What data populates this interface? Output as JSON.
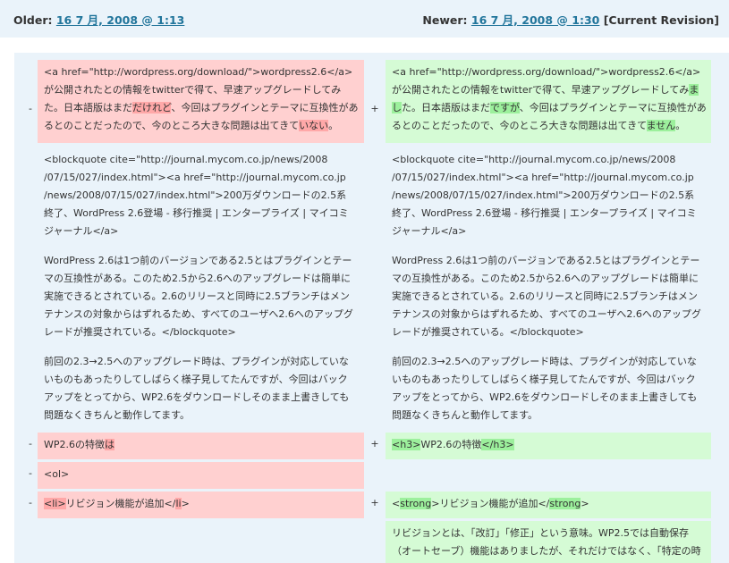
{
  "header": {
    "older_label": "Older:",
    "older_link": "16 7 月, 2008 @ 1:13",
    "newer_label": "Newer:",
    "newer_link": "16 7 月, 2008 @ 1:30",
    "current_revision": "[Current Revision]"
  },
  "markers": {
    "minus": "-",
    "plus": "+"
  },
  "colors": {
    "deleted_bg": "#ffd0d0",
    "inserted_bg": "#d5fbd5",
    "deleted_hl": "#ffa8a8",
    "inserted_hl": "#9cf09c",
    "link": "#21759b"
  },
  "rows": {
    "r1": {
      "left": {
        "l1": "<a href=\"http://wordpress.org/download/\">wordpress2.6</a>",
        "l2": "が公開されたとの情報をtwitterで得て、早速アップグレードしてみ",
        "l3a": "た。日本語版はまだ",
        "l3b": "だけれど",
        "l3c": "、今回はプラグインとテーマに互換性があ",
        "l4a": "るとのことだったので、今のところ大きな問題は出てきて",
        "l4b": "いない",
        "l4c": "。"
      },
      "right": {
        "l1": "<a href=\"http://wordpress.org/download/\">wordpress2.6</a>",
        "l2a": "が公開されたとの情報をtwitterで得て、早速アップグレードしてみ",
        "l2b": "ま",
        "l3a": "し",
        "l3b": "た。日本語版はまだ",
        "l3c": "ですが",
        "l3d": "、今回はプラグインとテーマに互換性があ",
        "l4a": "るとのことだったので、今のところ大きな問題は出てきて",
        "l4b": "ません",
        "l4c": "。"
      }
    },
    "r2": {
      "l1": "<blockquote cite=\"http://journal.mycom.co.jp/news/2008",
      "l2": "/07/15/027/index.html\"><a href=\"http://journal.mycom.co.jp",
      "l3": "/news/2008/07/15/027/index.html\">200万ダウンロードの2.5系",
      "l4": "終了、WordPress 2.6登場 - 移行推奨 | エンタープライズ | マイコミ",
      "l5": "ジャーナル</a>"
    },
    "r3": {
      "l1": "WordPress 2.6は1つ前のバージョンである2.5とはプラグインとテー",
      "l2": "マの互換性がある。このため2.5から2.6へのアップグレードは簡単に",
      "l3": "実施できるとされている。2.6のリリースと同時に2.5ブランチはメン",
      "l4": "テナンスの対象からはずれるため、すべてのユーザへ2.6へのアップグ",
      "l5": "レードが推奨されている。</blockquote>"
    },
    "r4": {
      "l1": "前回の2.3→2.5へのアップグレード時は、プラグインが対応していな",
      "l2": "いものもあったりしてしばらく様子見してたんですが、今回はバック",
      "l3": "アップをとってから、WP2.6をダウンロードしそのまま上書きしても",
      "l4": "問題なくきちんと動作してます。"
    },
    "r5": {
      "left_a": "WP2.6の特徴",
      "left_b": "は",
      "right_a": "<h3>",
      "right_b": "WP2.6の特徴",
      "right_c": "</h3>"
    },
    "r6": {
      "left": "<ol>"
    },
    "r7": {
      "left_a": "<li>",
      "left_b": "リビジョン機能が追加</",
      "left_c": "li",
      "left_d": ">",
      "right_a": "<",
      "right_b": "strong",
      "right_c": ">リビジョン機能が追加</",
      "right_d": "strong",
      "right_e": ">"
    },
    "r8": {
      "l1": "リビジョンとは、「改訂」「修正」という意味。WP2.5では自動保存",
      "l2": "（オートセーブ）機能はありましたが、それだけではなく、「特定の時"
    }
  }
}
